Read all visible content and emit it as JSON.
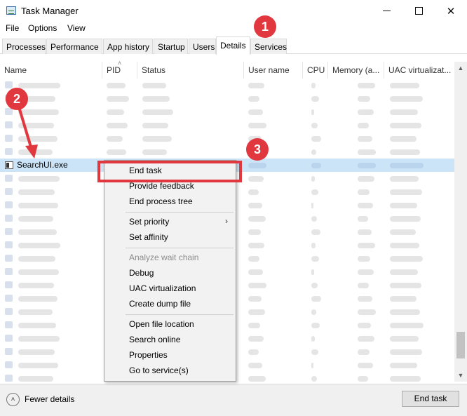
{
  "window": {
    "title": "Task Manager"
  },
  "menu": [
    "File",
    "Options",
    "View"
  ],
  "tabs": [
    {
      "label": "Processes",
      "active": false
    },
    {
      "label": "Performance",
      "active": false
    },
    {
      "label": "App history",
      "active": false
    },
    {
      "label": "Startup",
      "active": false
    },
    {
      "label": "Users",
      "active": false
    },
    {
      "label": "Details",
      "active": true
    },
    {
      "label": "Services",
      "active": false
    }
  ],
  "columns": [
    "Name",
    "PID",
    "Status",
    "User name",
    "CPU",
    "Memory (a...",
    "UAC virtualizat..."
  ],
  "selected_row": {
    "name": "SearchUI.exe"
  },
  "context_menu": {
    "items": [
      {
        "label": "End task"
      },
      {
        "label": "Provide feedback"
      },
      {
        "label": "End process tree"
      },
      {
        "label": "Set priority",
        "submenu": true
      },
      {
        "label": "Set affinity"
      },
      {
        "label": "Analyze wait chain",
        "disabled": true
      },
      {
        "label": "Debug"
      },
      {
        "label": "UAC virtualization"
      },
      {
        "label": "Create dump file"
      },
      {
        "label": "Open file location"
      },
      {
        "label": "Search online"
      },
      {
        "label": "Properties"
      },
      {
        "label": "Go to service(s)"
      }
    ]
  },
  "footer": {
    "fewer_details": "Fewer details",
    "end_task": "End task"
  },
  "annotations": [
    "1",
    "2",
    "3"
  ],
  "colors": {
    "annotation": "#e0383e",
    "selection": "#cce4f7",
    "menu_bg": "#f2f2f2"
  },
  "icons": [
    "task-manager-icon",
    "minimize-icon",
    "maximize-icon",
    "close-icon",
    "sort-up-icon",
    "process-icon",
    "chevron-right-icon",
    "chevron-up-circle-icon"
  ]
}
